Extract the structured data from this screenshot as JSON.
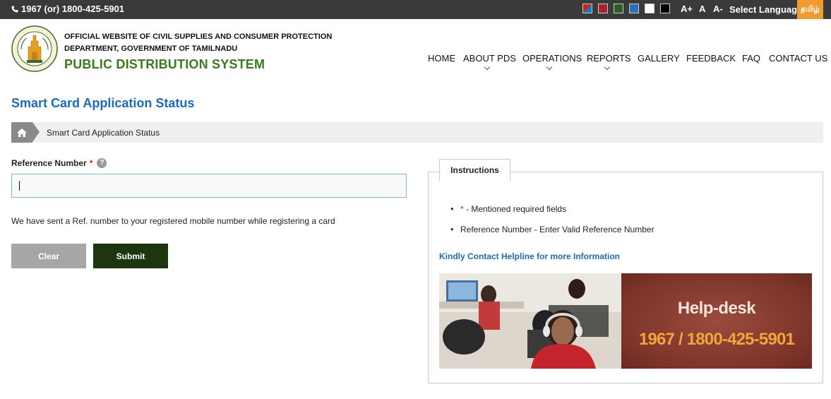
{
  "topbar": {
    "phone": "1967 (or) 1800-425-5901",
    "theme_colors": [
      "#4b67a8",
      "#a8232e",
      "#2a5e22",
      "#2d6fb8",
      "#ffffff",
      "#000000"
    ],
    "font_increase": "A+",
    "font_normal": "A",
    "font_decrease": "A-",
    "select_language": "Select Language",
    "tamil_label": "தமிழ்"
  },
  "header": {
    "dept_line1": "OFFICIAL WEBSITE OF CIVIL SUPPLIES AND CONSUMER PROTECTION",
    "dept_line2": "DEPARTMENT, GOVERNMENT OF TAMILNADU",
    "title": "PUBLIC DISTRIBUTION SYSTEM",
    "brand_color": "#3a7a1e"
  },
  "nav": {
    "items": [
      {
        "label": "HOME",
        "dropdown": false
      },
      {
        "label": "ABOUT PDS",
        "dropdown": true
      },
      {
        "label": "OPERATIONS",
        "dropdown": true
      },
      {
        "label": "REPORTS",
        "dropdown": true
      },
      {
        "label": "GALLERY",
        "dropdown": false
      },
      {
        "label": "FEEDBACK",
        "dropdown": false
      },
      {
        "label": "FAQ",
        "dropdown": false
      },
      {
        "label": "CONTACT US",
        "dropdown": false
      }
    ]
  },
  "page": {
    "title": "Smart Card Application Status",
    "breadcrumb": "Smart Card Application Status"
  },
  "form": {
    "ref_label": "Reference Number",
    "required_mark": "*",
    "help_mark": "?",
    "ref_value": "",
    "note": "We have sent a Ref. number to your registered mobile number while registering a card",
    "clear_label": "Clear",
    "submit_label": "Submit"
  },
  "instructions": {
    "tab_label": "Instructions",
    "item1_mark": "*",
    "item1_text": " - Mentioned required fields",
    "item2_text": "Reference Number - Enter Valid Reference Number",
    "contact_link": "Kindly Contact Helpline for more Information",
    "banner_title": "Help-desk",
    "banner_number": "1967 / 1800-425-5901"
  }
}
